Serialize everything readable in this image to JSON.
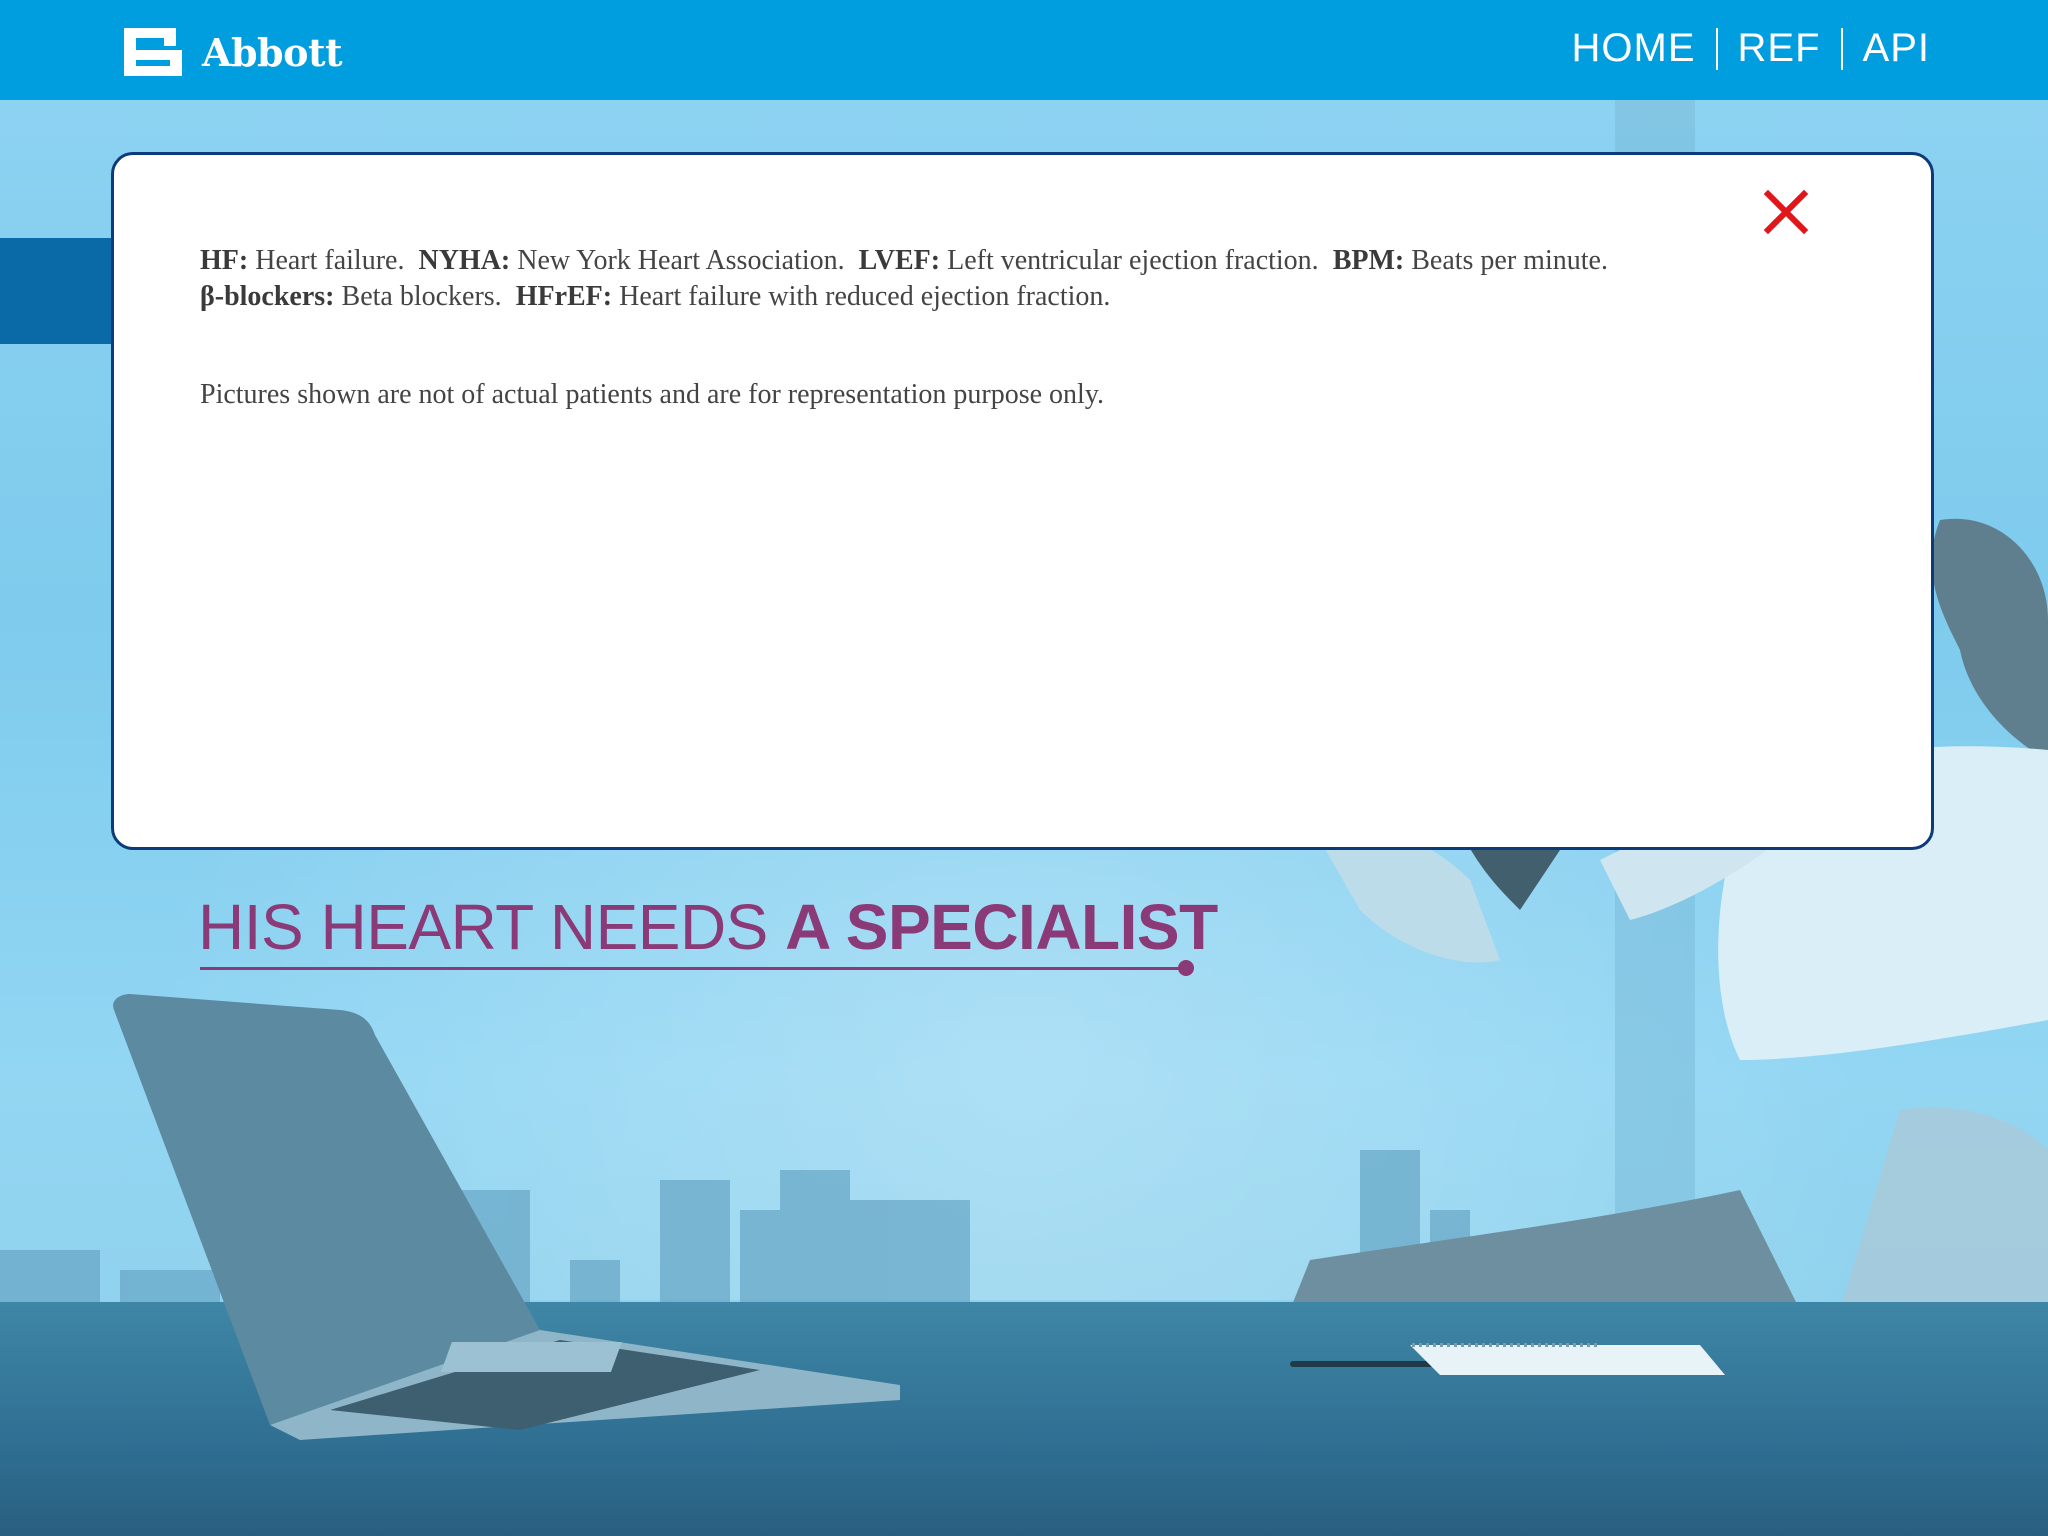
{
  "header": {
    "brand": "Abbott",
    "logo_icon": "abbott-logo-icon",
    "nav": [
      {
        "label": "HOME"
      },
      {
        "label": "REF"
      },
      {
        "label": "API"
      }
    ]
  },
  "modal": {
    "close_icon": "close-icon",
    "glossary": [
      {
        "term": "HF:",
        "definition": "Heart failure."
      },
      {
        "term": "NYHA:",
        "definition": "New York Heart Association."
      },
      {
        "term": "LVEF:",
        "definition": "Left ventricular ejection fraction."
      },
      {
        "term": "BPM:",
        "definition": "Beats per minute."
      },
      {
        "term": "β-blockers:",
        "definition": "Beta blockers."
      },
      {
        "term": "HFrEF:",
        "definition": "Heart failure with reduced ejection fraction."
      }
    ],
    "disclaimer": "Pictures shown are not of actual patients and are for representation purpose only."
  },
  "headline": {
    "light": "HIS HEART NEEDS ",
    "bold": "A SPECIALIST"
  },
  "colors": {
    "header_blue": "#009ddf",
    "headline_purple": "#8b3a78",
    "modal_border": "#0d3b7a",
    "close_red": "#e0161b"
  }
}
